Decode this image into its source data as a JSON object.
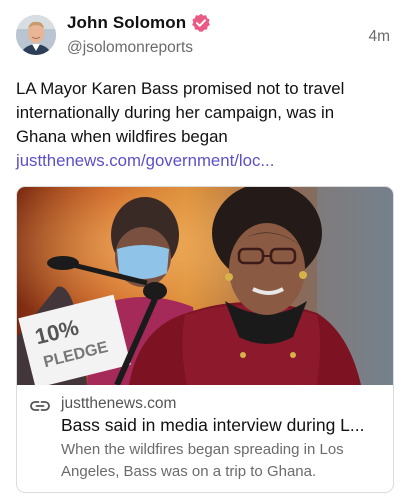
{
  "author": {
    "name": "John Solomon",
    "handle": "@jsolomonreports",
    "verified_color": "#ea5a85"
  },
  "timestamp": "4m",
  "post": {
    "text_lines": [
      "LA Mayor Karen Bass promised not to travel",
      "internationally during her campaign, was in",
      "Ghana when wildfires began"
    ],
    "link_text": "justthenews.com/government/loc..."
  },
  "link_card": {
    "domain": "justthenews.com",
    "title": "Bass said in media interview during L...",
    "description_lines": [
      "When the wildfires began spreading in Los",
      "Angeles, Bass was on a trip to Ghana."
    ],
    "icon": "link-icon"
  },
  "colors": {
    "link": "#5b50c8",
    "muted": "#6b6b6b"
  }
}
